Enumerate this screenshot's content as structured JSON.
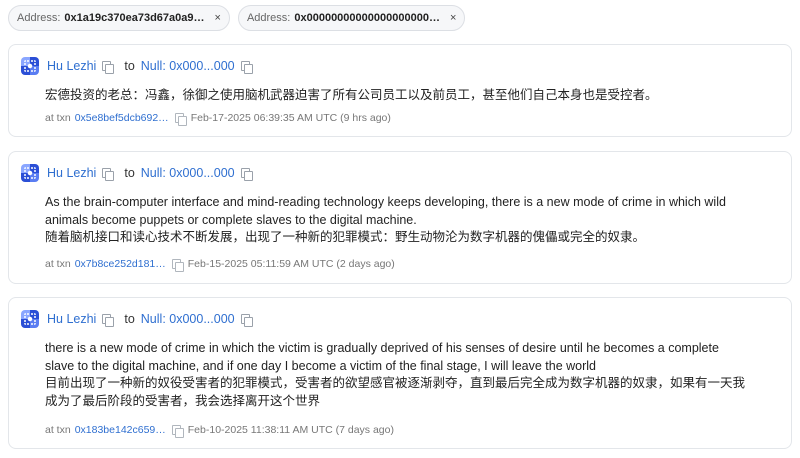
{
  "filters": [
    {
      "label": "Address:",
      "value": "0x1a19c370ea73d67a0a9…",
      "close": "×"
    },
    {
      "label": "Address:",
      "value": "0x00000000000000000000…",
      "close": "×"
    }
  ],
  "common": {
    "to": "to"
  },
  "messages": [
    {
      "sender": "Hu Lezhi",
      "recipient": "Null: 0x000...000",
      "lines": [
        "宏德投资的老总：冯鑫，徐御之使用脑机武器迫害了所有公司员工以及前员工，甚至他们自己本身也是受控者。"
      ],
      "txn_label": "at txn",
      "txn": "0x5e8bef5dcb692…",
      "timestamp": "Feb-17-2025 06:39:35 AM UTC (9 hrs ago)"
    },
    {
      "sender": "Hu Lezhi",
      "recipient": "Null: 0x000...000",
      "lines": [
        "As the brain-computer interface and mind-reading technology keeps developing, there is a new mode of crime in which wild",
        "animals become puppets or complete slaves to the digital machine.",
        "随着脑机接口和读心技术不断发展，出现了一种新的犯罪模式：野生动物沦为数字机器的傀儡或完全的奴隶。"
      ],
      "txn_label": "at txn",
      "txn": "0x7b8ce252d181…",
      "timestamp": "Feb-15-2025 05:11:59 AM UTC (2 days ago)"
    },
    {
      "sender": "Hu Lezhi",
      "recipient": "Null: 0x000...000",
      "lines": [
        "there is a new mode of crime in which the victim is gradually deprived of his senses of desire until he becomes a complete",
        "slave to the digital machine, and if one day I become a victim of the final stage, I will leave the world",
        "目前出现了一种新的奴役受害者的犯罪模式，受害者的欲望感官被逐渐剥夺，直到最后完全成为数字机器的奴隶，如果有一天我",
        "成为了最后阶段的受害者，我会选择离开这个世界"
      ],
      "txn_label": "at txn",
      "txn": "0x183be142c659…",
      "timestamp": "Feb-10-2025 11:38:11 AM UTC (7 days ago)"
    }
  ],
  "colors": {
    "link": "#2f6fd0",
    "border": "#e3e6ea"
  }
}
